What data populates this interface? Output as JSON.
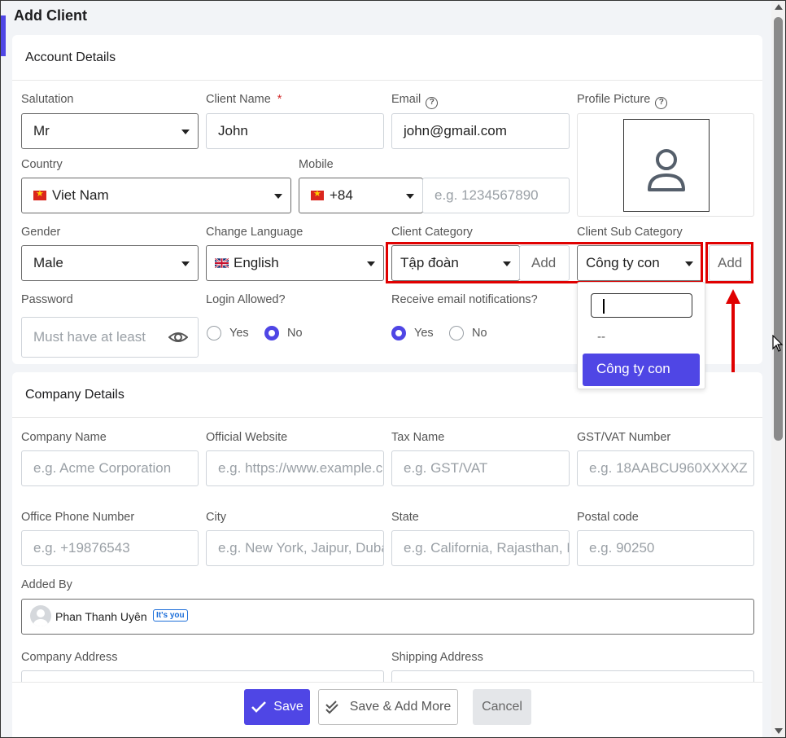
{
  "modal": {
    "title": "Add Client"
  },
  "account": {
    "heading": "Account Details",
    "salutation": {
      "label": "Salutation",
      "value": "Mr"
    },
    "client_name": {
      "label": "Client Name",
      "required": "*",
      "value": "John"
    },
    "email": {
      "label": "Email",
      "value": "john@gmail.com"
    },
    "profile_picture": {
      "label": "Profile Picture"
    },
    "country": {
      "label": "Country",
      "value": "Viet Nam"
    },
    "mobile": {
      "label": "Mobile",
      "code": "+84",
      "placeholder": "e.g. 1234567890"
    },
    "gender": {
      "label": "Gender",
      "value": "Male"
    },
    "language": {
      "label": "Change Language",
      "value": "English"
    },
    "client_category": {
      "label": "Client Category",
      "value": "Tập đoàn",
      "add_label": "Add"
    },
    "client_sub_category": {
      "label": "Client Sub Category",
      "value": "Công ty con",
      "add_label": "Add",
      "dropdown": {
        "none_option": "--",
        "options": [
          "Công ty con"
        ]
      }
    },
    "password": {
      "label": "Password",
      "placeholder": "Must have at least"
    },
    "login_allowed": {
      "label": "Login Allowed?",
      "yes": "Yes",
      "no": "No",
      "selected": "No"
    },
    "email_notifications": {
      "label": "Receive email notifications?",
      "yes": "Yes",
      "no": "No",
      "selected": "Yes"
    }
  },
  "company": {
    "heading": "Company Details",
    "company_name": {
      "label": "Company Name",
      "placeholder": "e.g. Acme Corporation"
    },
    "website": {
      "label": "Official Website",
      "placeholder": "e.g. https://www.example.com"
    },
    "tax_name": {
      "label": "Tax Name",
      "placeholder": "e.g. GST/VAT"
    },
    "gst": {
      "label": "GST/VAT Number",
      "placeholder": "e.g. 18AABCU960XXXXZ"
    },
    "office_phone": {
      "label": "Office Phone Number",
      "placeholder": "e.g. +19876543"
    },
    "city": {
      "label": "City",
      "placeholder": "e.g. New York, Jaipur, Dubai"
    },
    "state": {
      "label": "State",
      "placeholder": "e.g. California, Rajasthan, Dubai"
    },
    "postal_code": {
      "label": "Postal code",
      "placeholder": "e.g. 90250"
    },
    "added_by": {
      "label": "Added By",
      "name": "Phan Thanh Uyên",
      "badge": "It's you"
    },
    "company_address": {
      "label": "Company Address"
    },
    "shipping_address": {
      "label": "Shipping Address"
    }
  },
  "footer": {
    "save": "Save",
    "save_more": "Save & Add More",
    "cancel": "Cancel"
  },
  "colors": {
    "primary": "#4f46e5",
    "highlight": "#e00000"
  }
}
